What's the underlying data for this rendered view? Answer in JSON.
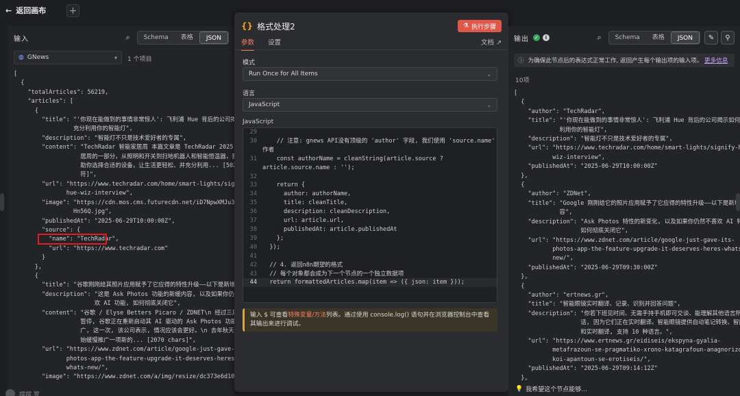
{
  "topbar": {
    "back_label": "返回画布"
  },
  "left": {
    "title": "输入",
    "views": [
      "Schema",
      "表格",
      "JSON"
    ],
    "source_name": "GNews",
    "items_count": "1 个项目",
    "code_lines": [
      "[",
      "  {",
      "    \"totalArticles\": 56219,",
      "    \"articles\": [",
      "      {",
      "        \"title\": \"'你现在能做到的事情非常惊人': 飞利浦 Hue 背后的公司揭示如何",
      "                 充分利用你的智能灯\",",
      "        \"description\": \"智能灯不只是技术爱好者的专属\",",
      "        \"content\": \"TechRadar 智能家居周 本篇文章是 TechRadar 2025 智能家",
      "                   居周的一部分，从照明和开关到扫地机器人和智能恒温器，我们将帮",
      "                   助你选择合适的设备，让生活更轻松、并充分利用... [5026 个字",
      "                   符]\",",
      "        \"url\": \"https://www.techradar.com/home/smart-lights/signify-",
      "               hue-wiz-interview\",",
      "        \"image\": \"https://cdn.mos.cms.futurecdn.net/iD7NpwXMJu3AyyeCW",
      "                 Hn56Q.jpg\",",
      "        \"publishedAt\": \"2025-06-29T10:00:00Z\",",
      "        \"source\": {",
      "          \"name\": \"TechRadar\",",
      "          \"url\": \"https://www.techradar.com\"",
      "        }",
      "      },",
      "      {",
      "        \"title\": \"谷歌刚刚给其照片应用赋予了它应得的特性升级——以下是新增内容\",",
      "        \"description\": \"这是 Ask Photos 功能的新缓内容, 以及如果你仍然不喜",
      "                       欢 AI 功能, 如何彻底关闭它\",",
      "        \"content\": \"谷歌 / Elyse Betters Picaro / ZDNET\\n 经过三周前的",
      "                   暂停, 谷歌正在重新启动其 AI 驱动的 Ask Photos 功能的推",
      "                   广, 这一次, 该公司表示, 情况应该会更好。\\n 去年秋天, 谷歌开",
      "                   始缓慢推广一项新的... [2070 chars]\",",
      "        \"url\": \"https://www.zdnet.com/article/google-just-gave-its-",
      "               photos-app-the-feature-upgrade-it-deserves-heres-",
      "               whats-new/\",",
      "        \"image\": \"https://www.zdnet.com/a/img/resize/dc373e6d1095e1c5"
    ],
    "user_name": "摆摆 罗"
  },
  "center": {
    "title": "格式处理2",
    "exec_label": "执行步骤",
    "tabs": [
      "参数",
      "设置"
    ],
    "docs_label": "文档",
    "mode_label": "模式",
    "mode_value": "Run Once for All Items",
    "lang_label": "语言",
    "lang_value": "JavaScript",
    "editor_label": "JavaScript",
    "editor_lines": [
      {
        "n": "29",
        "t": ""
      },
      {
        "n": "30",
        "t": "    // 注意: gnews API没有顶级的 'author' 字段, 我们使用 'source.name' 作为"
      },
      {
        "n": "",
        "t": "作者"
      },
      {
        "n": "31",
        "t": "    const authorName = cleanString(article.source ?"
      },
      {
        "n": "",
        "t": "article.source.name : '');"
      },
      {
        "n": "32",
        "t": ""
      },
      {
        "n": "33",
        "t": "    return {"
      },
      {
        "n": "34",
        "t": "      author: authorName,"
      },
      {
        "n": "35",
        "t": "      title: cleanTitle,"
      },
      {
        "n": "36",
        "t": "      description: cleanDescription,"
      },
      {
        "n": "37",
        "t": "      url: article.url,"
      },
      {
        "n": "38",
        "t": "      publishedAt: article.publishedAt"
      },
      {
        "n": "39",
        "t": "    };"
      },
      {
        "n": "40",
        "t": "  });"
      },
      {
        "n": "41",
        "t": ""
      },
      {
        "n": "42",
        "t": "  // 4. 返回n8n期望的格式"
      },
      {
        "n": "43",
        "t": "  // 每个对象都会成为下一个节点的一个独立数据项"
      },
      {
        "n": "44",
        "t": "  return formattedArticles.map(item => ({ json: item }));"
      }
    ],
    "hint_prefix": "输入 $ 可查看",
    "hint_link": "特殊变量/方法",
    "hint_suffix": "列表。通过使用 console.log() 语句并在浏览器控制台中查看其输出来进行调试。"
  },
  "right": {
    "title": "输出",
    "views": [
      "Schema",
      "表格",
      "JSON"
    ],
    "notice_text": "为确保此节点后的表达式正常工作, 返回产生每个输出项的输入项。",
    "notice_more": "更多信息",
    "items_count": "10项",
    "code_lines": [
      "[",
      "  {",
      "    \"author\": \"TechRadar\",",
      "    \"title\": \"'你现在能做到的事情非常惊人': 飞利浦 Hue 背后的公司揭示如何充分",
      "             利用你的智能灯\",",
      "    \"description\": \"智能灯不只是技术爱好者的专属\",",
      "    \"url\": \"https://www.techradar.com/home/smart-lights/signify-hue-",
      "           wiz-interview\",",
      "    \"publishedAt\": \"2025-06-29T10:00:00Z\"",
      "  },",
      "  {",
      "    \"author\": \"ZDNet\",",
      "    \"title\": \"Google 刚刚给它的照片应用赋予了它应得的特性升级——以下是新增内",
      "             容\",",
      "    \"description\": \"Ask Photos 特性的新变化, 以及如果你仍然不喜欢 AI 特性,",
      "                   如何彻底关闭它\",",
      "    \"url\": \"https://www.zdnet.com/article/google-just-gave-its-",
      "           photos-app-the-feature-upgrade-it-deserves-heres-whats-",
      "           new/\",",
      "    \"publishedAt\": \"2025-06-29T09:30:00Z\"",
      "  },",
      "  {",
      "    \"author\": \"ertnews.gr\",",
      "    \"title\": \"智能眼镜实时翻译、记录、识别并回答问题\",",
      "    \"description\": \"你若下班见时间、无需手持手机即可交谈、能理解其他语言所说的",
      "                   话, 因为它们正在实时翻译。智能眼镜提供自动笔记转换、智能摘要",
      "                   和实时翻译, 支持 10 种语言。\",",
      "    \"url\": \"https://www.ertnews.gr/eidiseis/ekspyna-gyalia-",
      "           metafrazoun-se-pragmatiko-xrono-katagrafoun-anagnorizoun-",
      "           koi-apantoun-se-erotiseis/\",",
      "    \"publishedAt\": \"2025-06-29T09:14:12Z\"",
      "  },",
      "  {"
    ],
    "ask_ai": "我希望这个节点能够..."
  },
  "colors": {
    "accent": "#e0584a",
    "success": "#3aa55c",
    "hint_border": "#d9a441"
  }
}
